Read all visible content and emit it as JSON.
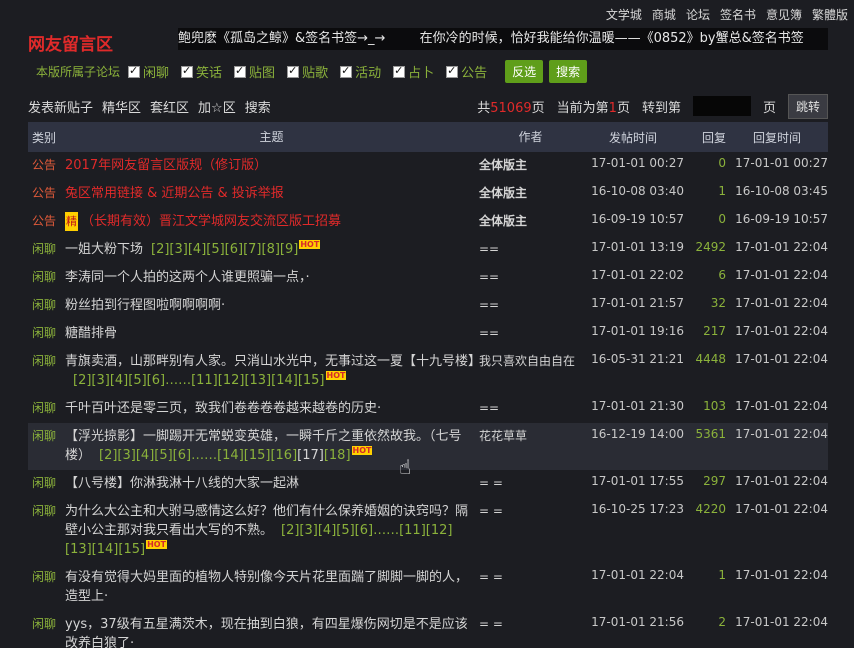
{
  "topnav": [
    "文学城",
    "商城",
    "论坛",
    "签名书",
    "意见簿",
    "繁體版"
  ],
  "site_title": "网友留言区",
  "marquee": [
    "鲍兜麽《孤岛之鲸》&签名书签→_→",
    "在你冷的时候，恰好我能给你温暖——《0852》by蟹总&签名书签"
  ],
  "filters": {
    "label": "本版所属子论坛",
    "items": [
      "闲聊",
      "笑话",
      "贴图",
      "贴歌",
      "活动",
      "占卜",
      "公告"
    ],
    "invert": "反选",
    "search": "搜索"
  },
  "toolbar": {
    "links": [
      "发表新贴子",
      "精华区",
      "套红区",
      "加☆区",
      "搜索"
    ],
    "total_pre": "共",
    "total": "51069",
    "total_post": "页",
    "current_pre": "当前为第",
    "current": "1",
    "current_post": "页",
    "goto_pre": "转到第",
    "goto_post": "页",
    "jump": "跳转"
  },
  "columns": [
    "类别",
    "主题",
    "作者",
    "发帖时间",
    "回复",
    "回复时间"
  ],
  "rows": [
    {
      "cat": "公告",
      "title": "2017年网友留言区版规（修订版）",
      "author": "全体版主",
      "date": "17-01-01 00:27",
      "rep": "0",
      "last": "17-01-01 00:27"
    },
    {
      "cat": "公告",
      "title": "兔区常用链接 & 近期公告 & 投诉举报",
      "author": "全体版主",
      "date": "16-10-08 03:40",
      "rep": "1",
      "last": "16-10-08 03:45"
    },
    {
      "cat": "公告",
      "jing": "精",
      "title": "（长期有效）晋江文学城网友交流区版工招募",
      "author": "全体版主",
      "date": "16-09-19 10:57",
      "rep": "0",
      "last": "16-09-19 10:57"
    },
    {
      "cat": "闲聊",
      "title": "一姐大粉下场",
      "pages": "[2][3][4][5][6][7][8][9]",
      "hot": "HOT",
      "author": "==",
      "date": "17-01-01 13:19",
      "rep": "2492",
      "last": "17-01-01 22:04"
    },
    {
      "cat": "闲聊",
      "title": "李涛同一个人拍的这两个人谁更照骗一点，·",
      "author": "==",
      "date": "17-01-01 22:02",
      "rep": "6",
      "last": "17-01-01 22:04"
    },
    {
      "cat": "闲聊",
      "title": "粉丝拍到行程图啦啊啊啊啊·",
      "author": "==",
      "date": "17-01-01 21:57",
      "rep": "32",
      "last": "17-01-01 22:04"
    },
    {
      "cat": "闲聊",
      "title": "糖醋排骨",
      "author": "==",
      "date": "17-01-01 19:16",
      "rep": "217",
      "last": "17-01-01 22:04"
    },
    {
      "cat": "闲聊",
      "title": "青旗卖酒，山那畔别有人家。只消山水光中，无事过这一夏【十九号楼】",
      "pages": "[2][3][4][5][6]……[11][12][13][14][15]",
      "hot": "HOT",
      "author": "我只喜欢自由自在",
      "date": "16-05-31 21:21",
      "rep": "4448",
      "last": "17-01-01 22:04"
    },
    {
      "cat": "闲聊",
      "title": "千叶百叶还是零三页，致我们卷卷卷卷越来越卷的历史·",
      "author": "==",
      "date": "17-01-01 21:30",
      "rep": "103",
      "last": "17-01-01 22:04"
    },
    {
      "cat": "闲聊",
      "title": "【浮光掠影】一脚踢开无常蜕变英雄，一瞬千斤之重依然故我。（七号楼）",
      "pages_a": "[2][3][4][5][6]……[14][15][16]",
      "pages_cur": "[17]",
      "pages_b": "[18]",
      "hot": "HOT",
      "author": "花花草草",
      "date": "16-12-19 14:00",
      "rep": "5361",
      "last": "17-01-01 22:04",
      "hover": true
    },
    {
      "cat": "闲聊",
      "title": "【八号楼】你淋我淋十八线的大家一起淋",
      "author": "= =",
      "date": "17-01-01 17:55",
      "rep": "297",
      "last": "17-01-01 22:04"
    },
    {
      "cat": "闲聊",
      "title": "为什么大公主和大驸马感情这么好？他们有什么保养婚姻的诀窍吗？隔壁小公主那对我只看出大写的不熟。",
      "pages": "[2][3][4][5][6]……[11][12][13][14][15]",
      "hot": "HOT",
      "author": "= =",
      "date": "16-10-25 17:23",
      "rep": "4220",
      "last": "17-01-01 22:04"
    },
    {
      "cat": "闲聊",
      "title": "有没有觉得大妈里面的植物人特别像今天片花里面踹了脚脚一脚的人，造型上·",
      "author": "= =",
      "date": "17-01-01 22:04",
      "rep": "1",
      "last": "17-01-01 22:04"
    },
    {
      "cat": "闲聊",
      "title": "yys，37级有五星满茨木，现在抽到白狼，有四星爆伤网切是不是应该改养白狼了·",
      "author": "= =",
      "date": "17-01-01 21:56",
      "rep": "2",
      "last": "17-01-01 22:04"
    }
  ]
}
